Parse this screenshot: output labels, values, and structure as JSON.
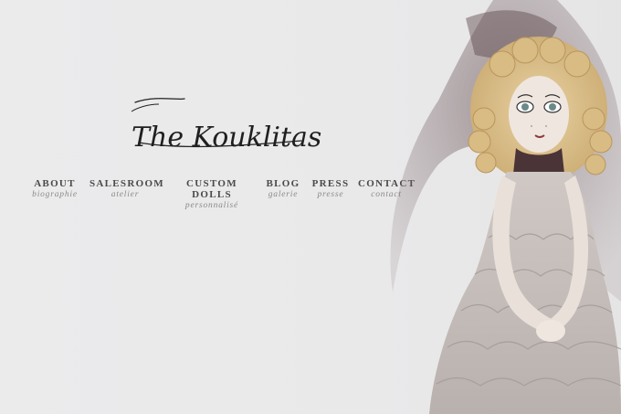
{
  "brand": {
    "logo_text": "The Kouklitas"
  },
  "nav": [
    {
      "label": "ABOUT",
      "sub": "biographie"
    },
    {
      "label": "SALESROOM",
      "sub": "atelier"
    },
    {
      "label": "CUSTOM DOLLS",
      "sub": "personnalisé"
    },
    {
      "label": "BLOG",
      "sub": "galerie"
    },
    {
      "label": "PRESS",
      "sub": "presse"
    },
    {
      "label": "CONTACT",
      "sub": "contact"
    }
  ],
  "colors": {
    "background": "#ebebec",
    "nav_text": "#4a4a4a",
    "nav_sub": "#8a8a8a"
  }
}
